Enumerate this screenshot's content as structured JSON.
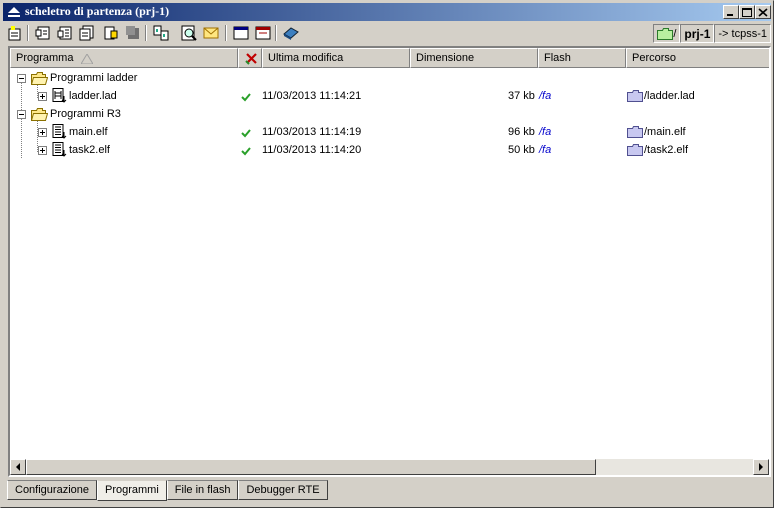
{
  "window": {
    "title": "scheletro di partenza (prj-1)",
    "controls": [
      "minimize",
      "maximize",
      "close"
    ]
  },
  "toolbar": {
    "icons": [
      "new-project-icon",
      "open-file-icon",
      "save-file-icon",
      "save-all-icon",
      "print-icon",
      "stop-icon",
      "compare-icon",
      "find-icon",
      "mail-icon",
      "window-icon",
      "window-alt-icon",
      "book-icon"
    ],
    "project_path": "/",
    "project_name": "prj-1",
    "target": "-> tcpss-1"
  },
  "list": {
    "columns": {
      "programma": "Programma",
      "ultima_modifica": "Ultima modifica",
      "dimensione": "Dimensione",
      "flash": "Flash",
      "percorso": "Percorso"
    },
    "groups": [
      {
        "label": "Programmi ladder",
        "items": [
          {
            "name": "ladder.lad",
            "status": "ok",
            "modified": "11/03/2013 11:14:21",
            "size": "37 kb",
            "flash": "/fa",
            "path": "/ladder.lad"
          }
        ]
      },
      {
        "label": "Programmi R3",
        "items": [
          {
            "name": "main.elf",
            "status": "ok",
            "modified": "11/03/2013 11:14:19",
            "size": "96 kb",
            "flash": "/fa",
            "path": "/main.elf"
          },
          {
            "name": "task2.elf",
            "status": "ok",
            "modified": "11/03/2013 11:14:20",
            "size": "50 kb",
            "flash": "/fa",
            "path": "/task2.elf"
          }
        ]
      }
    ]
  },
  "tabs": [
    {
      "label": "Configurazione",
      "active": false
    },
    {
      "label": "Programmi",
      "active": true
    },
    {
      "label": "File in flash",
      "active": false
    },
    {
      "label": "Debugger RTE",
      "active": false
    }
  ],
  "colors": {
    "titlebar_start": "#0a246a",
    "titlebar_end": "#a6caf0",
    "check_green": "#2aa02a",
    "link_blue": "#0000cc"
  }
}
